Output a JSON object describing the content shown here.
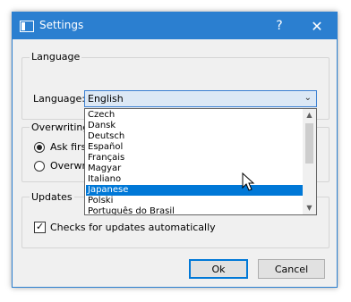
{
  "window": {
    "title": "Settings"
  },
  "titlebar": {
    "help_glyph": "?",
    "close_glyph": "✕"
  },
  "language_group": {
    "label": "Language",
    "field_label": "Language:",
    "selected": "English",
    "options": [
      "Czech",
      "Dansk",
      "Deutsch",
      "Español",
      "Français",
      "Magyar",
      "Italiano",
      "Japanese",
      "Polski",
      "Português do Brasil"
    ],
    "highlighted": "Japanese"
  },
  "overwriting_group": {
    "label": "Overwriting",
    "options": [
      {
        "label": "Ask firs",
        "checked": true
      },
      {
        "label": "Overwrit",
        "checked": false
      }
    ]
  },
  "updates_group": {
    "label": "Updates",
    "checkbox_label": "Checks for updates automatically",
    "checked": true
  },
  "buttons": {
    "ok": "Ok",
    "cancel": "Cancel"
  },
  "colors": {
    "title_bar": "#2b7fd0",
    "highlight": "#0078d7"
  },
  "icons": [
    "app-icon",
    "help-icon",
    "close-icon",
    "chevron-down-icon",
    "scroll-up-icon",
    "scroll-down-icon",
    "mouse-cursor-icon"
  ]
}
